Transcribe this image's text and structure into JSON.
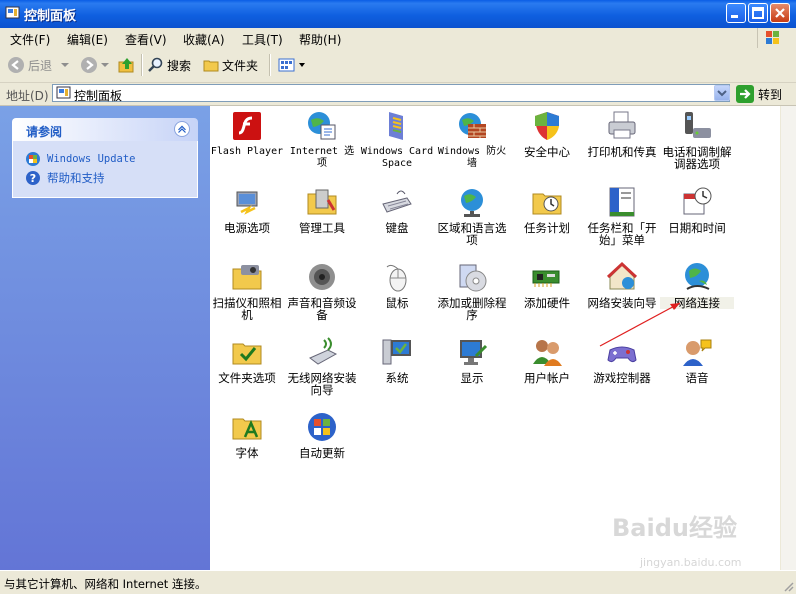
{
  "window": {
    "title": "控制面板"
  },
  "menu": [
    "文件(F)",
    "编辑(E)",
    "查看(V)",
    "收藏(A)",
    "工具(T)",
    "帮助(H)"
  ],
  "toolbar": {
    "back": "后退",
    "search": "搜索",
    "folders": "文件夹"
  },
  "address": {
    "label": "地址(D)",
    "value": "控制面板",
    "go": "转到"
  },
  "see_also": {
    "title": "请参阅",
    "links": [
      "Windows Update",
      "帮助和支持"
    ]
  },
  "items": [
    {
      "label": "Flash Player",
      "icon": "flash-icon"
    },
    {
      "label": "Internet 选项",
      "icon": "internet-options-icon"
    },
    {
      "label": "Windows CardSpace",
      "icon": "cardspace-icon"
    },
    {
      "label": "Windows 防火墙",
      "icon": "firewall-icon"
    },
    {
      "label": "安全中心",
      "icon": "security-shield-icon"
    },
    {
      "label": "打印机和传真",
      "icon": "printer-icon"
    },
    {
      "label": "电话和调制解调器选项",
      "icon": "phone-modem-icon"
    },
    {
      "label": "电源选项",
      "icon": "power-icon"
    },
    {
      "label": "管理工具",
      "icon": "admin-tools-icon"
    },
    {
      "label": "键盘",
      "icon": "keyboard-icon"
    },
    {
      "label": "区域和语言选项",
      "icon": "globe-clock-icon"
    },
    {
      "label": "任务计划",
      "icon": "scheduled-tasks-icon"
    },
    {
      "label": "任务栏和「开始」菜单",
      "icon": "taskbar-icon"
    },
    {
      "label": "日期和时间",
      "icon": "datetime-icon"
    },
    {
      "label": "扫描仪和照相机",
      "icon": "scanner-icon"
    },
    {
      "label": "声音和音频设备",
      "icon": "speaker-icon"
    },
    {
      "label": "鼠标",
      "icon": "mouse-icon"
    },
    {
      "label": "添加或删除程序",
      "icon": "add-remove-icon"
    },
    {
      "label": "添加硬件",
      "icon": "add-hardware-icon"
    },
    {
      "label": "网络安装向导",
      "icon": "network-wizard-icon"
    },
    {
      "label": "网络连接",
      "icon": "network-connections-icon"
    },
    {
      "label": "文件夹选项",
      "icon": "folder-options-icon"
    },
    {
      "label": "无线网络安装向导",
      "icon": "wireless-icon"
    },
    {
      "label": "系统",
      "icon": "system-icon"
    },
    {
      "label": "显示",
      "icon": "display-icon"
    },
    {
      "label": "用户帐户",
      "icon": "user-accounts-icon"
    },
    {
      "label": "游戏控制器",
      "icon": "gamepad-icon"
    },
    {
      "label": "语音",
      "icon": "speech-icon"
    },
    {
      "label": "字体",
      "icon": "fonts-folder-icon"
    },
    {
      "label": "自动更新",
      "icon": "windows-update-icon"
    }
  ],
  "status": {
    "text": "与其它计算机、网络和 Internet 连接。"
  },
  "watermark": {
    "logo": "Baidu经验",
    "url": "jingyan.baidu.com"
  }
}
